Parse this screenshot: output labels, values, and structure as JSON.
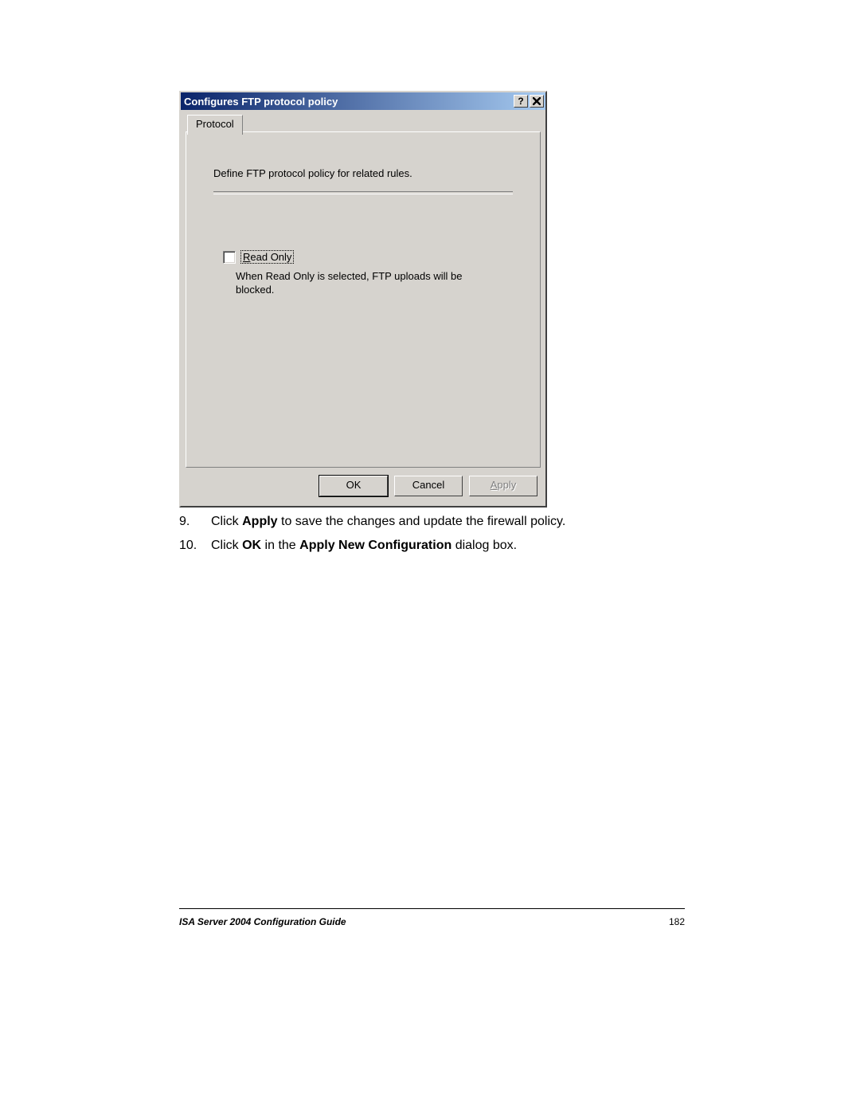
{
  "dialog": {
    "title": "Configures FTP protocol policy",
    "help_button_glyph": "?",
    "tab_label": "Protocol",
    "description": "Define FTP protocol policy for related rules.",
    "checkbox": {
      "underlined_char": "R",
      "rest_label": "ead Only",
      "help_text": "When Read Only is selected, FTP uploads will be blocked."
    },
    "buttons": {
      "ok": "OK",
      "cancel": "Cancel",
      "apply_underlined": "A",
      "apply_rest": "pply"
    }
  },
  "steps": {
    "nine_num": "9.",
    "nine_pre": "Click ",
    "nine_bold": "Apply",
    "nine_post": " to save the changes and update the firewall policy.",
    "ten_num": "10.",
    "ten_pre": "Click ",
    "ten_b1": "OK",
    "ten_mid": " in the ",
    "ten_b2": "Apply New Configuration",
    "ten_post": " dialog box."
  },
  "footer": {
    "left": "ISA Server 2004 Configuration Guide",
    "page": "182"
  }
}
